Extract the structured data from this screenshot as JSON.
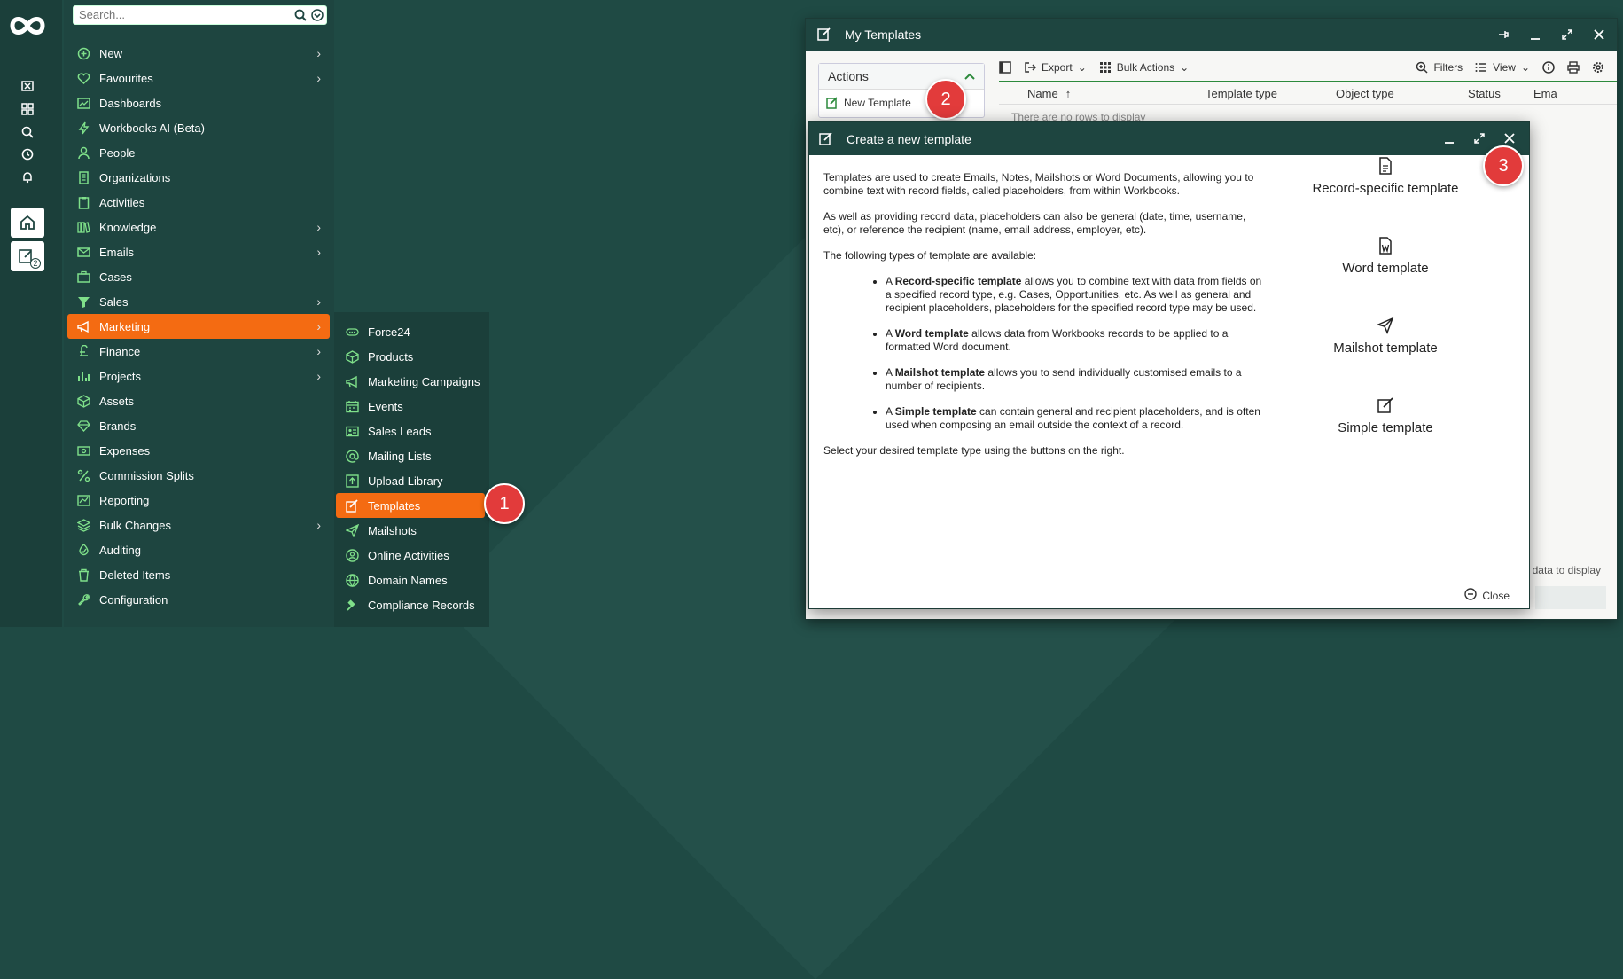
{
  "search": {
    "placeholder": "Search..."
  },
  "rail": {
    "badge_count": "2"
  },
  "menu": {
    "items": [
      {
        "label": "New",
        "icon": "plus-circle-icon",
        "chev": true
      },
      {
        "label": "Favourites",
        "icon": "heart-icon",
        "chev": true
      },
      {
        "label": "Dashboards",
        "icon": "dashboard-icon",
        "chev": false
      },
      {
        "label": "Workbooks AI (Beta)",
        "icon": "lightning-icon",
        "chev": false
      },
      {
        "label": "People",
        "icon": "person-icon",
        "chev": false
      },
      {
        "label": "Organizations",
        "icon": "building-icon",
        "chev": false
      },
      {
        "label": "Activities",
        "icon": "clipboard-icon",
        "chev": false
      },
      {
        "label": "Knowledge",
        "icon": "books-icon",
        "chev": true
      },
      {
        "label": "Emails",
        "icon": "envelope-icon",
        "chev": true
      },
      {
        "label": "Cases",
        "icon": "briefcase-icon",
        "chev": false
      },
      {
        "label": "Sales",
        "icon": "funnel-icon",
        "chev": true
      },
      {
        "label": "Marketing",
        "icon": "megaphone-icon",
        "chev": true,
        "active": true
      },
      {
        "label": "Finance",
        "icon": "pound-icon",
        "chev": true
      },
      {
        "label": "Projects",
        "icon": "chart-bar-icon",
        "chev": true
      },
      {
        "label": "Assets",
        "icon": "cube-icon",
        "chev": false
      },
      {
        "label": "Brands",
        "icon": "diamond-icon",
        "chev": false
      },
      {
        "label": "Expenses",
        "icon": "money-icon",
        "chev": false
      },
      {
        "label": "Commission Splits",
        "icon": "percent-icon",
        "chev": false
      },
      {
        "label": "Reporting",
        "icon": "report-icon",
        "chev": false
      },
      {
        "label": "Bulk Changes",
        "icon": "layers-icon",
        "chev": true
      },
      {
        "label": "Auditing",
        "icon": "audit-icon",
        "chev": false
      },
      {
        "label": "Deleted Items",
        "icon": "trash-icon",
        "chev": false
      },
      {
        "label": "Configuration",
        "icon": "wrench-icon",
        "chev": false
      }
    ]
  },
  "submenu": {
    "items": [
      {
        "label": "Force24",
        "icon": "force24-icon"
      },
      {
        "label": "Products",
        "icon": "box-icon"
      },
      {
        "label": "Marketing Campaigns",
        "icon": "megaphone-icon"
      },
      {
        "label": "Events",
        "icon": "calendar-icon"
      },
      {
        "label": "Sales Leads",
        "icon": "id-card-icon"
      },
      {
        "label": "Mailing Lists",
        "icon": "at-icon"
      },
      {
        "label": "Upload Library",
        "icon": "upload-icon"
      },
      {
        "label": "Templates",
        "icon": "edit-icon",
        "active": true
      },
      {
        "label": "Mailshots",
        "icon": "send-icon"
      },
      {
        "label": "Online Activities",
        "icon": "user-circle-icon"
      },
      {
        "label": "Domain Names",
        "icon": "globe-icon"
      },
      {
        "label": "Compliance Records",
        "icon": "gavel-icon"
      }
    ]
  },
  "callouts": {
    "one": "1",
    "two": "2",
    "three": "3"
  },
  "my_templates": {
    "title": "My Templates",
    "actions_title": "Actions",
    "new_template": "New Template",
    "toolbar": {
      "export": "Export",
      "bulk_actions": "Bulk Actions",
      "filters": "Filters",
      "view": "View"
    },
    "columns": [
      "Name",
      "Template type",
      "Object type",
      "Status",
      "Ema"
    ],
    "empty": "There are no rows to display",
    "footer": "data to display"
  },
  "dialog": {
    "title": "Create a new template",
    "para1": "Templates are used to create Emails, Notes, Mailshots or Word Documents, allowing you to combine text with record fields, called placeholders, from within Workbooks.",
    "para2": "As well as providing record data, placeholders can also be general (date, time, username, etc), or reference the recipient (name, email address, employer, etc).",
    "para3": "The following types of template are available:",
    "bullets": [
      {
        "bold": "Record-specific template",
        "text": " allows you to combine text with data from fields on a specified record type, e.g. Cases, Opportunities, etc. As well as general and recipient placeholders, placeholders for the specified record type may be used."
      },
      {
        "bold": "Word template",
        "text": " allows data from Workbooks records to be applied to a formatted Word document."
      },
      {
        "bold": "Mailshot template",
        "text": " allows you to send individually customised emails to a number of recipients."
      },
      {
        "bold": "Simple template",
        "text": " can contain general and recipient placeholders, and is often used when composing an email outside the context of a record."
      }
    ],
    "bullet_prefix": "A ",
    "para4": "Select your desired template type using the buttons on the right.",
    "buttons": [
      "Record-specific template",
      "Word template",
      "Mailshot template",
      "Simple template"
    ],
    "close": "Close"
  },
  "colors": {
    "accent": "#f46b12",
    "dark": "#1e4540",
    "green": "#7fe08a",
    "callout": "#e23b3b"
  }
}
